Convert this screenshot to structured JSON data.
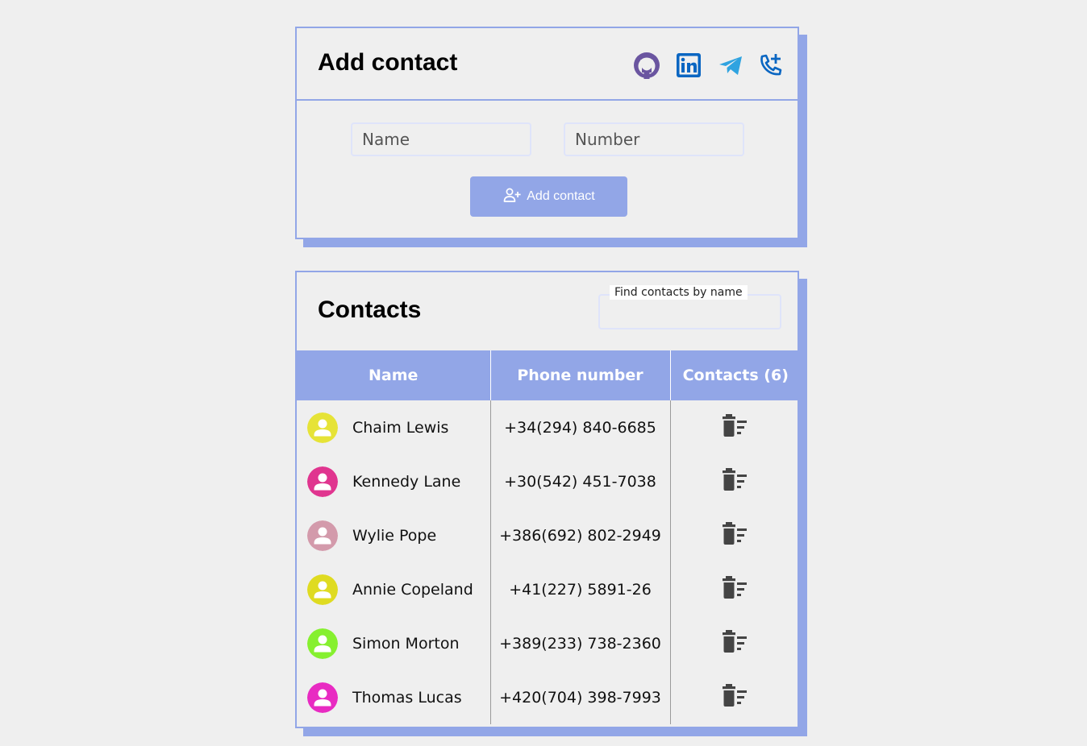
{
  "add_section": {
    "title": "Add contact",
    "social_icons": [
      "github-icon",
      "linkedin-icon",
      "telegram-icon",
      "phone-add-icon"
    ],
    "name_placeholder": "Name",
    "number_placeholder": "Number",
    "button_label": "Add contact",
    "button_icon": "person-add-icon"
  },
  "contacts_section": {
    "title": "Contacts",
    "filter_label": "Find contacts by name",
    "filter_value": "",
    "columns": [
      "Name",
      "Phone number",
      "Contacts (6)"
    ],
    "rows": [
      {
        "name": "Chaim Lewis",
        "phone": "+34(294) 840-6685",
        "avatar_color": "#e6e337"
      },
      {
        "name": "Kennedy Lane",
        "phone": "+30(542) 451-7038",
        "avatar_color": "#e0358f"
      },
      {
        "name": "Wylie Pope",
        "phone": "+386(692) 802-2949",
        "avatar_color": "#d39aab"
      },
      {
        "name": "Annie Copeland",
        "phone": "+41(227) 5891-26",
        "avatar_color": "#dfdb21"
      },
      {
        "name": "Simon Morton",
        "phone": "+389(233) 738-2360",
        "avatar_color": "#86f02f"
      },
      {
        "name": "Thomas Lucas",
        "phone": "+420(704) 398-7993",
        "avatar_color": "#e82bc2"
      }
    ],
    "row_action_icon": "delete-sweep-icon"
  },
  "colors": {
    "accent": "#92a6e7",
    "background": "#efefef",
    "input_border": "#dfe4fa"
  }
}
